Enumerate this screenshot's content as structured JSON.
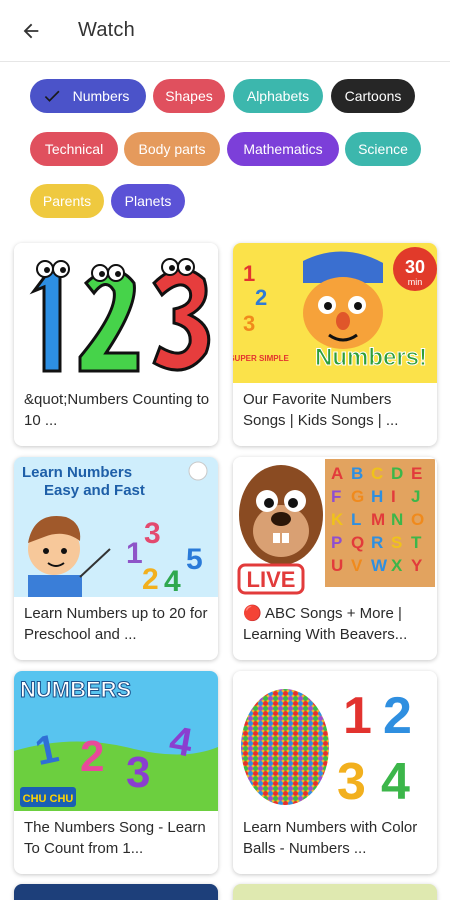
{
  "header": {
    "title": "Watch",
    "back_icon": "arrow-left-icon"
  },
  "filters": [
    {
      "label": "Numbers",
      "color": "#4b53c9",
      "selected": true
    },
    {
      "label": "Shapes",
      "color": "#e0505e",
      "selected": false
    },
    {
      "label": "Alphabets",
      "color": "#3cb7ad",
      "selected": false
    },
    {
      "label": "Cartoons",
      "color": "#262626",
      "selected": false
    },
    {
      "label": "Technical",
      "color": "#e0505e",
      "selected": false
    },
    {
      "label": "Body parts",
      "color": "#e59a5c",
      "selected": false
    },
    {
      "label": "Mathematics",
      "color": "#7c3fd9",
      "selected": false
    },
    {
      "label": "Science",
      "color": "#3cb7ad",
      "selected": false
    },
    {
      "label": "Parents",
      "color": "#efc93f",
      "selected": false
    },
    {
      "label": "Planets",
      "color": "#5b52d6",
      "selected": false
    }
  ],
  "videos": [
    {
      "title": "&quot;Numbers Counting to 10 ...",
      "thumb_text": []
    },
    {
      "title": "Our Favorite Numbers Songs | Kids Songs | ...",
      "thumb_text": [
        "30",
        "min",
        "Numbers!",
        "SUPER SIMPLE"
      ]
    },
    {
      "title": "Learn Numbers up to 20 for Preschool and ...",
      "thumb_text": [
        "Learn Numbers",
        "Easy and Fast"
      ]
    },
    {
      "title": "🔴 ABC Songs + More | Learning With Beavers...",
      "thumb_text": [
        "LIVE"
      ]
    },
    {
      "title": "The Numbers Song - Learn To Count from 1...",
      "thumb_text": [
        "NUMBERS",
        "CHU CHU"
      ]
    },
    {
      "title": "Learn Numbers with Color Balls - Numbers ...",
      "thumb_text": []
    }
  ]
}
